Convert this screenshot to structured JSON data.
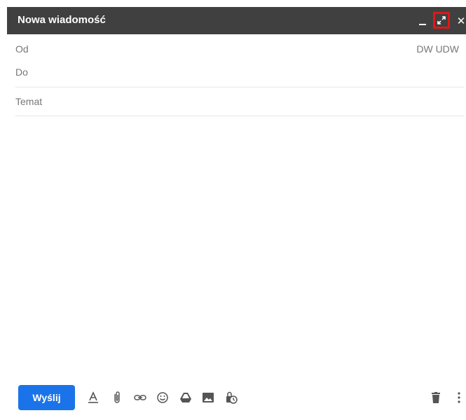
{
  "header": {
    "title": "Nowa wiadomość"
  },
  "fields": {
    "from_label": "Od",
    "to_label": "Do",
    "subject_placeholder": "Temat"
  },
  "cc_links": {
    "cc": "DW",
    "bcc": "UDW"
  },
  "toolbar": {
    "send_label": "Wyślij",
    "icons": [
      "format-text-icon",
      "attach-icon",
      "link-icon",
      "emoji-icon",
      "drive-icon",
      "photo-icon",
      "confidential-icon",
      "trash-icon",
      "more-options-icon"
    ]
  },
  "colors": {
    "header_bg": "#404040",
    "send_bg": "#1a73e8",
    "highlight": "#e01818"
  }
}
